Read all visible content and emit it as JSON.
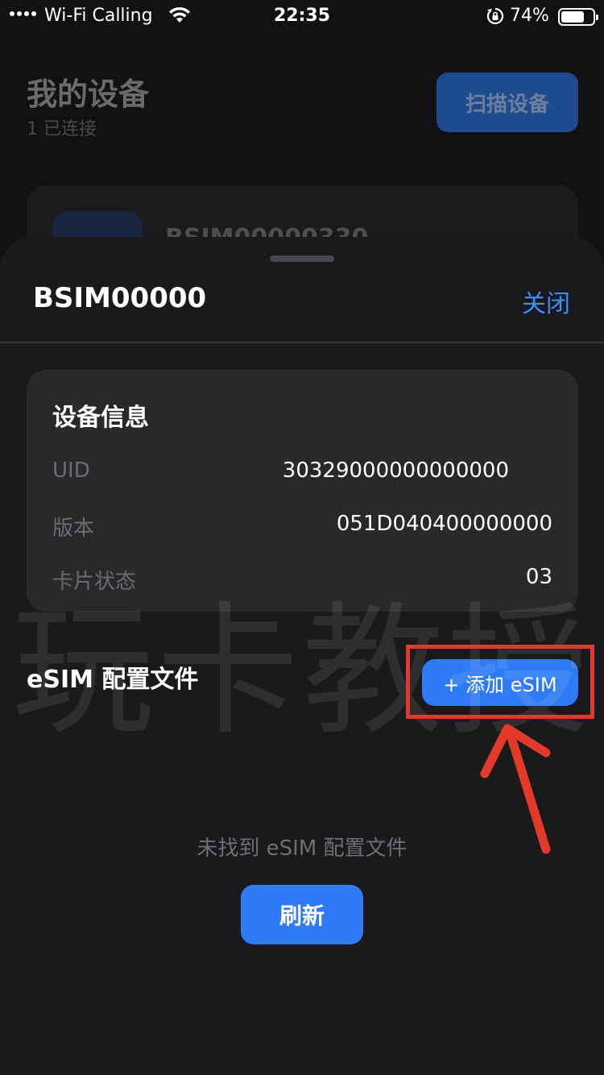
{
  "status_bar": {
    "carrier": "Wi-Fi Calling",
    "time": "22:35",
    "battery": "74%",
    "battery_level": 0.74
  },
  "background_page": {
    "title": "我的设备",
    "subtitle": "1 已连接",
    "scan_button": "扫描设备",
    "device_name": "BSIM00000330"
  },
  "sheet": {
    "title": "BSIM00000",
    "close_label": "关闭",
    "device_info": {
      "heading": "设备信息",
      "rows": [
        {
          "label": "UID",
          "value": "30329000000000000"
        },
        {
          "label": "版本",
          "value": "051D040400000000"
        },
        {
          "label": "卡片状态",
          "value": "03"
        }
      ]
    },
    "esim_section": {
      "title": "eSIM 配置文件",
      "add_button": "+ 添加 eSIM",
      "empty_text": "未找到 eSIM 配置文件",
      "refresh_button": "刷新"
    }
  },
  "overlay": {
    "watermark": "玩卡教授"
  },
  "colors": {
    "accent": "#2f7bf5",
    "link": "#3d8bff",
    "annotation": "#e2392b"
  }
}
